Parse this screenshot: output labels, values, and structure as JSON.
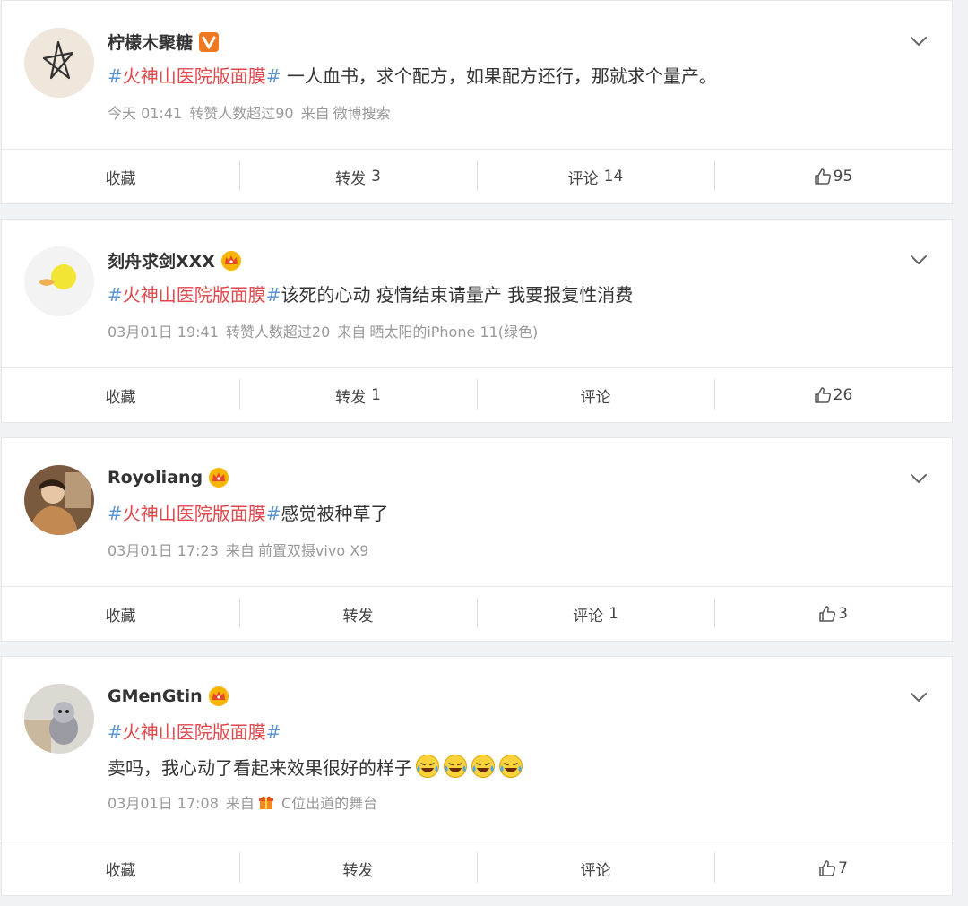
{
  "posts": [
    {
      "username": "柠檬木聚糖",
      "badge": "verified-v-badge",
      "hashtag": "火神山医院版面膜",
      "text": " 一人血书，求个配方，如果配方还行，那就求个量产。",
      "time": "今天 01:41",
      "reposts_note": "转赞人数超过90",
      "source_prefix": "来自",
      "source": "微博搜索",
      "actions": {
        "favorite": "收藏",
        "repost": "转发",
        "repost_count": "3",
        "comment": "评论",
        "comment_count": "14",
        "likes": "95"
      }
    },
    {
      "username": "刻舟求剑XXX",
      "badge": "crown-badge",
      "hashtag": "火神山医院版面膜",
      "text": "该死的心动 疫情结束请量产 我要报复性消费",
      "time": "03月01日 19:41",
      "reposts_note": "转赞人数超过20",
      "source_prefix": "来自",
      "source": "晒太阳的iPhone 11(绿色)",
      "actions": {
        "favorite": "收藏",
        "repost": "转发",
        "repost_count": "1",
        "comment": "评论",
        "comment_count": "",
        "likes": "26"
      }
    },
    {
      "username": "Royoliang",
      "badge": "crown-badge",
      "hashtag": "火神山医院版面膜",
      "text": "感觉被种草了",
      "time": "03月01日 17:23",
      "reposts_note": "",
      "source_prefix": "来自",
      "source": "前置双摄vivo X9",
      "actions": {
        "favorite": "收藏",
        "repost": "转发",
        "repost_count": "",
        "comment": "评论",
        "comment_count": "1",
        "likes": "3"
      }
    },
    {
      "username": "GMenGtin",
      "badge": "crown-badge",
      "hashtag": "火神山医院版面膜",
      "text": "卖吗，我心动了看起来效果很好的样子",
      "emojis": [
        "laugh-cry-emoji",
        "laugh-cry-emoji",
        "laugh-cry-emoji",
        "laugh-cry-emoji"
      ],
      "time": "03月01日 17:08",
      "reposts_note": "",
      "source_prefix": "来自",
      "source": "C位出道的舞台",
      "actions": {
        "favorite": "收藏",
        "repost": "转发",
        "repost_count": "",
        "comment": "评论",
        "comment_count": "",
        "likes": "7"
      }
    }
  ],
  "hash_symbol": "#",
  "colors": {
    "hashtag_symbol": "#5d94d6",
    "hashtag_text": "#e0474b",
    "meta": "#999999",
    "background": "#f1f2f5"
  }
}
